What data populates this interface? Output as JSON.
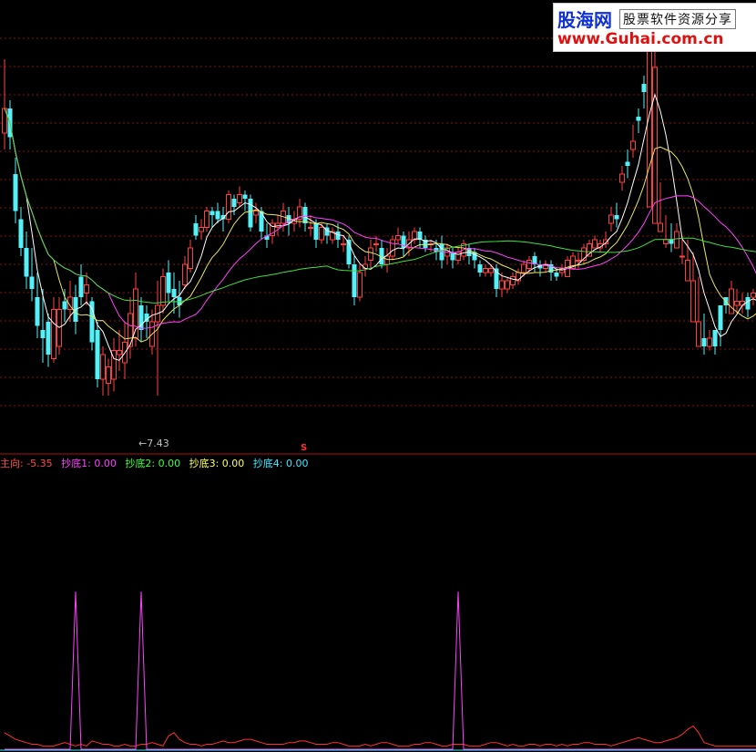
{
  "watermark": {
    "brand": "股海网",
    "tagline": "股票软件资源分享",
    "url": "www.Guhai.com.cn"
  },
  "main_panel": {
    "low_marker": "←7.43",
    "signal_marker": "S"
  },
  "indicator_legend": [
    {
      "label": "主向: -5.35",
      "color": "#ff4a4a"
    },
    {
      "label": "抄底1: 0.00",
      "color": "#ff40ff"
    },
    {
      "label": "抄底2: 0.00",
      "color": "#40ff40"
    },
    {
      "label": "抄底3: 0.00",
      "color": "#ffff60"
    },
    {
      "label": "抄底4: 0.00",
      "color": "#40e8ff"
    }
  ],
  "colors": {
    "up": "#ff4040",
    "down": "#54f2f8",
    "grid": "#8a1010",
    "ma_fast": "#ffffff",
    "ma_mid": "#e8e85a",
    "ma_slow": "#ff40ff",
    "ma_long": "#40e040",
    "indicator_main": "#ff3030",
    "indicator_signal": "#ff40ff"
  },
  "chart_data": [
    {
      "type": "candlestick",
      "title": "",
      "ylim": [
        7.0,
        12.0
      ],
      "grid": true,
      "x": [
        0,
        1,
        2,
        3,
        4,
        5,
        6,
        7,
        8,
        9,
        10,
        11,
        12,
        13,
        14,
        15,
        16,
        17,
        18,
        19,
        20,
        21,
        22,
        23,
        24,
        25,
        26,
        27,
        28,
        29,
        30,
        31,
        32,
        33,
        34,
        35,
        36,
        37,
        38,
        39,
        40,
        41,
        42,
        43,
        44,
        45,
        46,
        47,
        48,
        49,
        50,
        51,
        52,
        53,
        54,
        55,
        56,
        57,
        58,
        59,
        60,
        61,
        62,
        63,
        64,
        65,
        66,
        67,
        68,
        69,
        70,
        71,
        72,
        73,
        74,
        75,
        76,
        77,
        78,
        79,
        80,
        81,
        82,
        83,
        84,
        85,
        86,
        87,
        88,
        89,
        90,
        91,
        92,
        93,
        94,
        95,
        96,
        97,
        98,
        99,
        100,
        101,
        102,
        103,
        104,
        105,
        106,
        107,
        108,
        109,
        110,
        111,
        112,
        113,
        114,
        115,
        116,
        117,
        118,
        119,
        120,
        121,
        122,
        123,
        124,
        125,
        126,
        127,
        128,
        129,
        130,
        131,
        132,
        133,
        134,
        135,
        136,
        137
      ],
      "open": [
        10.6,
        10.9,
        10.1,
        9.55,
        9.2,
        8.85,
        8.6,
        8.2,
        8.3,
        7.85,
        8.0,
        8.55,
        8.45,
        8.6,
        8.85,
        8.65,
        8.55,
        8.2,
        7.6,
        7.55,
        7.6,
        7.9,
        7.8,
        8.0,
        8.1,
        8.5,
        8.4,
        8.0,
        8.3,
        8.5,
        8.9,
        8.7,
        8.6,
        8.75,
        8.95,
        9.5,
        9.4,
        9.45,
        9.65,
        9.65,
        9.6,
        9.55,
        9.8,
        9.75,
        9.85,
        9.8,
        9.6,
        9.65,
        9.35,
        9.35,
        9.45,
        9.5,
        9.6,
        9.5,
        9.55,
        9.7,
        9.45,
        9.5,
        9.3,
        9.45,
        9.3,
        9.4,
        9.25,
        9.3,
        9.0,
        8.6,
        8.95,
        9.05,
        9.25,
        9.2,
        9.0,
        9.1,
        9.3,
        9.35,
        9.2,
        9.3,
        9.4,
        9.3,
        9.25,
        9.2,
        9.25,
        9.1,
        9.15,
        9.05,
        9.1,
        9.2,
        9.15,
        9.0,
        8.9,
        8.9,
        8.95,
        8.7,
        8.7,
        8.75,
        8.8,
        8.9,
        8.95,
        9.1,
        9.0,
        8.95,
        9.0,
        8.9,
        8.9,
        8.85,
        8.95,
        9.05,
        9.05,
        9.1,
        9.2,
        9.2,
        9.25,
        9.5,
        9.6,
        10.0,
        10.25,
        10.4,
        10.8,
        11.2,
        9.7,
        9.5,
        9.4,
        9.25,
        9.3,
        9.2,
        9.1,
        8.8,
        8.3,
        8.0,
        8.1,
        8.0,
        8.2,
        8.5,
        8.6,
        8.4,
        8.5,
        8.5,
        8.6,
        8.6
      ],
      "close": [
        10.9,
        10.55,
        9.65,
        9.2,
        8.85,
        8.7,
        8.25,
        8.1,
        7.9,
        8.45,
        8.45,
        8.45,
        8.6,
        8.3,
        8.6,
        8.75,
        8.05,
        7.6,
        7.9,
        7.75,
        7.95,
        7.95,
        8.05,
        8.4,
        8.7,
        8.2,
        8.3,
        8.3,
        8.5,
        8.85,
        8.65,
        8.6,
        8.5,
        9.0,
        9.2,
        9.35,
        9.45,
        9.65,
        9.6,
        9.55,
        9.55,
        9.85,
        9.7,
        9.85,
        9.8,
        9.45,
        9.65,
        9.4,
        9.3,
        9.5,
        9.5,
        9.65,
        9.5,
        9.55,
        9.7,
        9.5,
        9.45,
        9.3,
        9.45,
        9.35,
        9.4,
        9.3,
        9.25,
        9.0,
        8.6,
        8.9,
        9.0,
        9.2,
        9.25,
        9.0,
        9.1,
        9.3,
        9.35,
        9.2,
        9.3,
        9.4,
        9.3,
        9.2,
        9.25,
        9.15,
        9.05,
        9.2,
        9.05,
        9.15,
        9.25,
        9.1,
        9.05,
        8.9,
        8.95,
        8.95,
        8.7,
        8.8,
        8.8,
        8.85,
        8.9,
        9.0,
        9.05,
        9.0,
        8.95,
        9.0,
        8.9,
        8.85,
        8.95,
        9.05,
        9.1,
        9.05,
        9.2,
        9.25,
        9.3,
        9.25,
        9.3,
        9.6,
        9.55,
        10.1,
        10.2,
        10.5,
        10.75,
        11.1,
        11.6,
        11.4,
        9.5,
        9.3,
        9.25,
        9.4,
        9.1,
        9.05,
        8.8,
        8.3,
        8.0,
        8.1,
        8.0,
        8.2,
        8.5,
        8.7,
        8.55,
        8.55,
        8.45,
        8.65,
        8.55,
        8.5
      ],
      "high": [
        11.5,
        11.0,
        10.3,
        9.7,
        9.4,
        9.2,
        8.9,
        8.7,
        8.4,
        8.6,
        8.6,
        8.7,
        8.8,
        8.75,
        9.0,
        8.9,
        8.6,
        8.3,
        8.0,
        7.85,
        8.1,
        8.2,
        8.3,
        8.6,
        8.9,
        8.6,
        8.5,
        8.45,
        8.8,
        8.95,
        9.05,
        8.9,
        8.8,
        9.1,
        9.3,
        9.6,
        9.55,
        9.7,
        9.7,
        9.75,
        9.7,
        9.9,
        9.85,
        9.95,
        9.9,
        9.85,
        9.75,
        9.7,
        9.5,
        9.55,
        9.6,
        9.75,
        9.7,
        9.65,
        9.8,
        9.75,
        9.6,
        9.55,
        9.5,
        9.5,
        9.45,
        9.5,
        9.35,
        9.35,
        9.1,
        9.0,
        9.1,
        9.3,
        9.35,
        9.3,
        9.2,
        9.35,
        9.45,
        9.4,
        9.4,
        9.45,
        9.45,
        9.35,
        9.3,
        9.3,
        9.35,
        9.25,
        9.2,
        9.2,
        9.3,
        9.25,
        9.2,
        9.05,
        9.0,
        9.0,
        9.0,
        8.9,
        8.85,
        8.9,
        8.95,
        9.05,
        9.1,
        9.15,
        9.05,
        9.05,
        9.05,
        8.95,
        9.0,
        9.1,
        9.15,
        9.15,
        9.25,
        9.3,
        9.35,
        9.3,
        9.4,
        9.7,
        9.75,
        10.2,
        10.4,
        10.7,
        10.9,
        11.3,
        11.8,
        11.9,
        10.0,
        9.6,
        9.5,
        9.5,
        9.35,
        9.3,
        9.15,
        8.85,
        8.4,
        8.2,
        8.2,
        8.3,
        8.6,
        8.8,
        8.7,
        8.65,
        8.65,
        8.7,
        8.7,
        8.65
      ],
      "low": [
        10.4,
        10.4,
        9.5,
        9.1,
        8.7,
        8.55,
        8.1,
        7.8,
        7.75,
        7.8,
        7.9,
        8.3,
        8.3,
        8.15,
        8.5,
        8.5,
        7.95,
        7.5,
        7.4,
        7.4,
        7.45,
        7.7,
        7.6,
        7.85,
        8.0,
        8.05,
        8.1,
        7.9,
        7.4,
        8.4,
        8.55,
        8.4,
        8.35,
        8.7,
        8.9,
        9.3,
        9.3,
        9.4,
        9.45,
        9.5,
        9.4,
        9.5,
        9.6,
        9.7,
        9.65,
        9.4,
        9.5,
        9.3,
        9.2,
        9.25,
        9.35,
        9.4,
        9.35,
        9.4,
        9.45,
        9.4,
        9.35,
        9.2,
        9.25,
        9.25,
        9.25,
        9.2,
        9.15,
        8.95,
        8.5,
        8.55,
        8.85,
        8.95,
        9.15,
        8.95,
        8.9,
        9.05,
        9.25,
        9.1,
        9.1,
        9.25,
        9.2,
        9.15,
        9.15,
        9.05,
        8.95,
        9.0,
        8.95,
        9.0,
        9.05,
        9.0,
        8.95,
        8.85,
        8.85,
        8.85,
        8.6,
        8.6,
        8.65,
        8.7,
        8.75,
        8.85,
        8.9,
        8.9,
        8.85,
        8.9,
        8.8,
        8.8,
        8.85,
        8.95,
        9.0,
        8.95,
        9.0,
        9.15,
        9.2,
        9.15,
        9.2,
        9.4,
        9.45,
        9.9,
        10.05,
        10.3,
        10.6,
        10.9,
        11.0,
        11.2,
        9.4,
        9.2,
        9.15,
        9.2,
        9.0,
        8.95,
        8.7,
        8.2,
        7.9,
        7.95,
        7.9,
        8.0,
        8.4,
        8.5,
        8.4,
        8.4,
        8.35,
        8.5,
        8.45,
        8.4
      ]
    },
    {
      "type": "line",
      "title": "",
      "ylim": [
        0,
        100
      ],
      "series": [
        {
          "name": "主向",
          "values": [
            10,
            8,
            6,
            5,
            4,
            3,
            3,
            2,
            2,
            2,
            3,
            4,
            3,
            2,
            3,
            2,
            5,
            4,
            3,
            3,
            2,
            2,
            3,
            2,
            2,
            3,
            3,
            4,
            3,
            2,
            8,
            10,
            6,
            4,
            3,
            3,
            2,
            3,
            3,
            4,
            5,
            4,
            4,
            5,
            6,
            6,
            5,
            4,
            3,
            3,
            3,
            3,
            4,
            4,
            5,
            5,
            4,
            3,
            3,
            3,
            4,
            4,
            3,
            2,
            2,
            2,
            3,
            2,
            3,
            4,
            4,
            3,
            2,
            2,
            2,
            3,
            3,
            4,
            4,
            3,
            2,
            2,
            3,
            3,
            3,
            2,
            2,
            2,
            3,
            4,
            4,
            3,
            2,
            3,
            2,
            2,
            3,
            3,
            2,
            3,
            3,
            2,
            3,
            2,
            3,
            3,
            4,
            4,
            3,
            3,
            3,
            2,
            3,
            4,
            5,
            6,
            7,
            6,
            5,
            4,
            4,
            5,
            6,
            7,
            9,
            12,
            14,
            10,
            4,
            3,
            2,
            2,
            2,
            2,
            2,
            2,
            2,
            2,
            2,
            2
          ]
        },
        {
          "name": "抄底",
          "values": [
            0,
            0,
            0,
            0,
            0,
            0,
            0,
            0,
            0,
            0,
            0,
            0,
            0,
            95,
            0,
            0,
            0,
            0,
            0,
            0,
            0,
            0,
            0,
            0,
            0,
            95,
            0,
            0,
            0,
            0,
            0,
            0,
            0,
            0,
            0,
            0,
            0,
            0,
            0,
            0,
            0,
            0,
            0,
            0,
            0,
            0,
            0,
            0,
            0,
            0,
            0,
            0,
            0,
            0,
            0,
            0,
            0,
            0,
            0,
            0,
            0,
            0,
            0,
            0,
            0,
            0,
            0,
            0,
            0,
            0,
            0,
            0,
            0,
            0,
            0,
            0,
            0,
            0,
            0,
            0,
            0,
            0,
            0,
            95,
            0,
            0,
            0,
            0,
            0,
            0,
            0,
            0,
            0,
            0,
            0,
            0,
            0,
            0,
            0,
            0,
            0,
            0,
            0,
            0,
            0,
            0,
            0,
            0,
            0,
            0,
            0,
            0,
            0,
            0,
            0,
            0,
            0,
            0,
            0,
            0,
            0,
            0,
            0,
            0,
            0,
            0,
            0,
            0,
            0,
            0,
            0,
            0,
            0,
            0,
            0,
            0,
            0,
            0,
            0,
            0
          ]
        }
      ]
    }
  ]
}
